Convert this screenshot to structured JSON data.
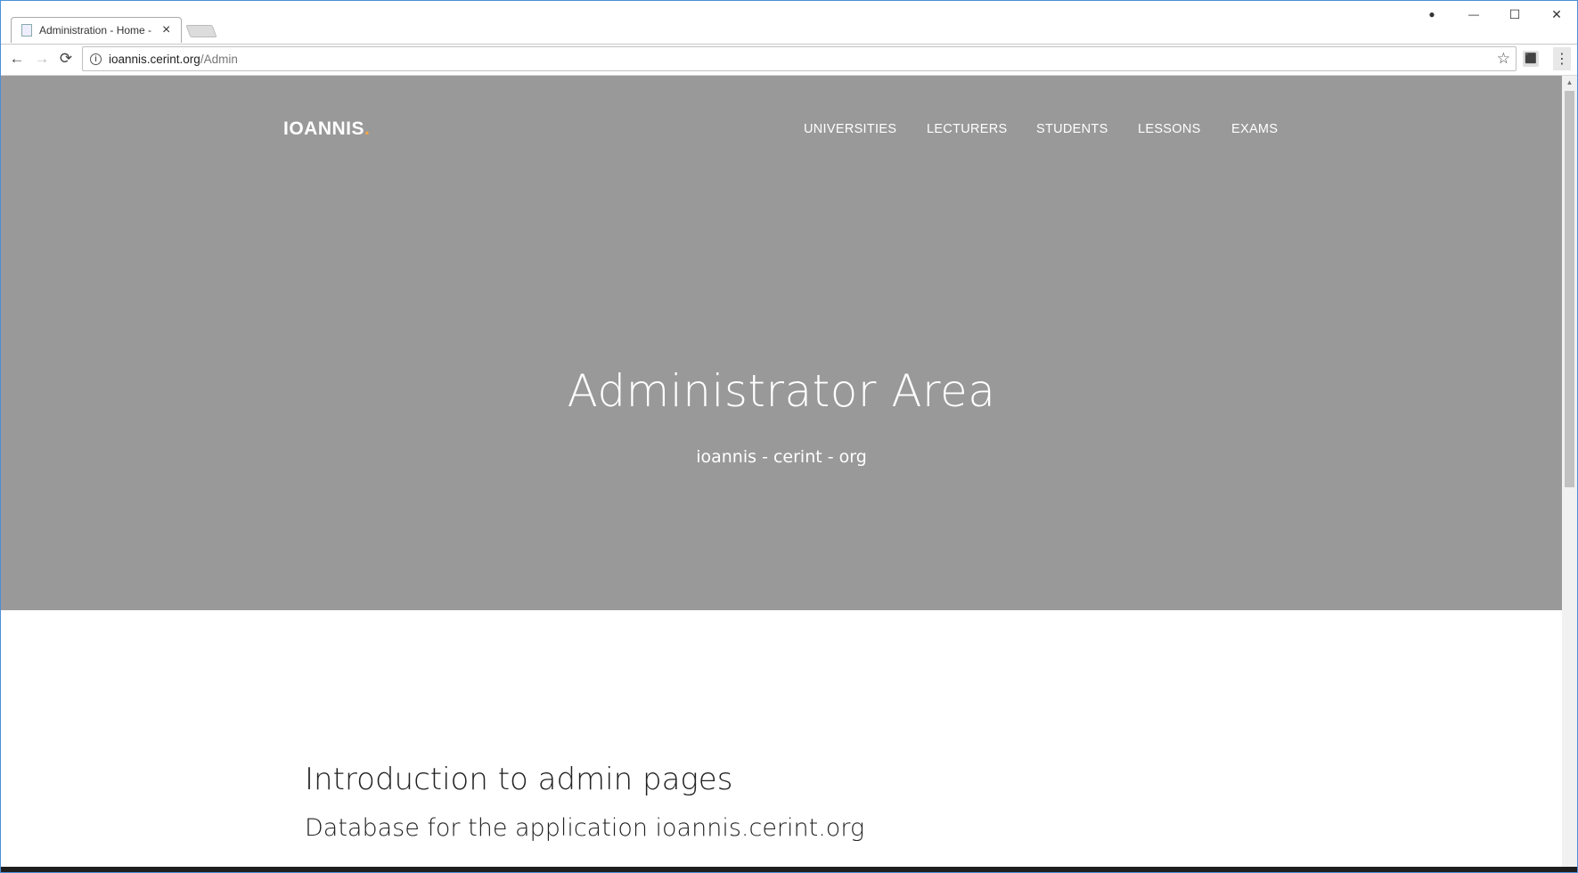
{
  "browser": {
    "tab_title": "Administration - Home -",
    "tab_close": "×",
    "url_host": "ioannis.cerint.org",
    "url_path": "/Admin",
    "back": "←",
    "forward": "→",
    "reload": "⟳",
    "star": "☆",
    "menu": "⋮",
    "account": "●",
    "minimize": "—",
    "maximize": "☐",
    "close": "✕"
  },
  "site": {
    "brand": "IOANNIS",
    "brand_dot": ".",
    "nav": [
      "UNIVERSITIES",
      "LECTURERS",
      "STUDENTS",
      "LESSONS",
      "EXAMS"
    ],
    "hero_title": "Administrator Area",
    "hero_subtitle": "ioannis - cerint - org",
    "intro_title": "Introduction to admin pages",
    "intro_subtitle": "Database for the application ioannis.cerint.org"
  },
  "colors": {
    "hero_bg": "#999999",
    "brand_accent": "#f5a742"
  }
}
